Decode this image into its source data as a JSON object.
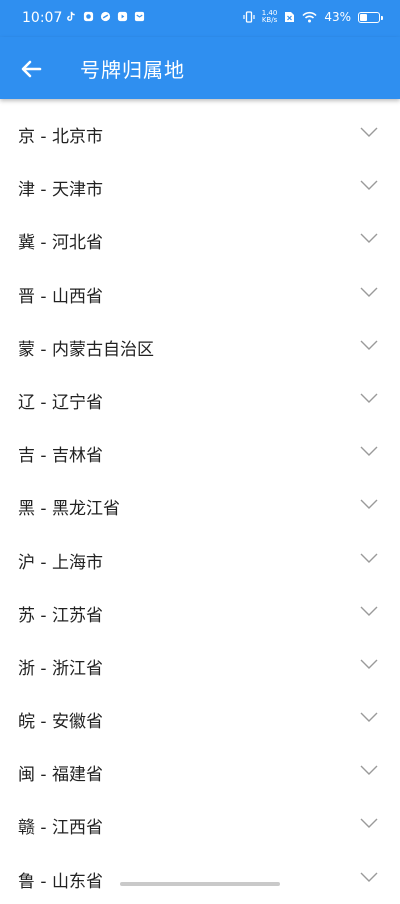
{
  "status": {
    "time": "10:07",
    "speed_value": "1.40",
    "speed_unit": "KB/s",
    "battery": "43%",
    "battery_level": 0.43
  },
  "app_bar": {
    "title": "号牌归属地",
    "back_icon": "arrow-left-icon"
  },
  "items": [
    {
      "label": "京 - 北京市"
    },
    {
      "label": "津 - 天津市"
    },
    {
      "label": "冀 - 河北省"
    },
    {
      "label": "晋 - 山西省"
    },
    {
      "label": "蒙 - 内蒙古自治区"
    },
    {
      "label": "辽 - 辽宁省"
    },
    {
      "label": "吉 - 吉林省"
    },
    {
      "label": "黑 - 黑龙江省"
    },
    {
      "label": "沪 - 上海市"
    },
    {
      "label": "苏 - 江苏省"
    },
    {
      "label": "浙 - 浙江省"
    },
    {
      "label": "皖 - 安徽省"
    },
    {
      "label": "闽 - 福建省"
    },
    {
      "label": "赣 - 江西省"
    },
    {
      "label": "鲁 - 山东省"
    }
  ],
  "colors": {
    "primary": "#2f8ff0",
    "chevron": "#9a9a9a"
  }
}
